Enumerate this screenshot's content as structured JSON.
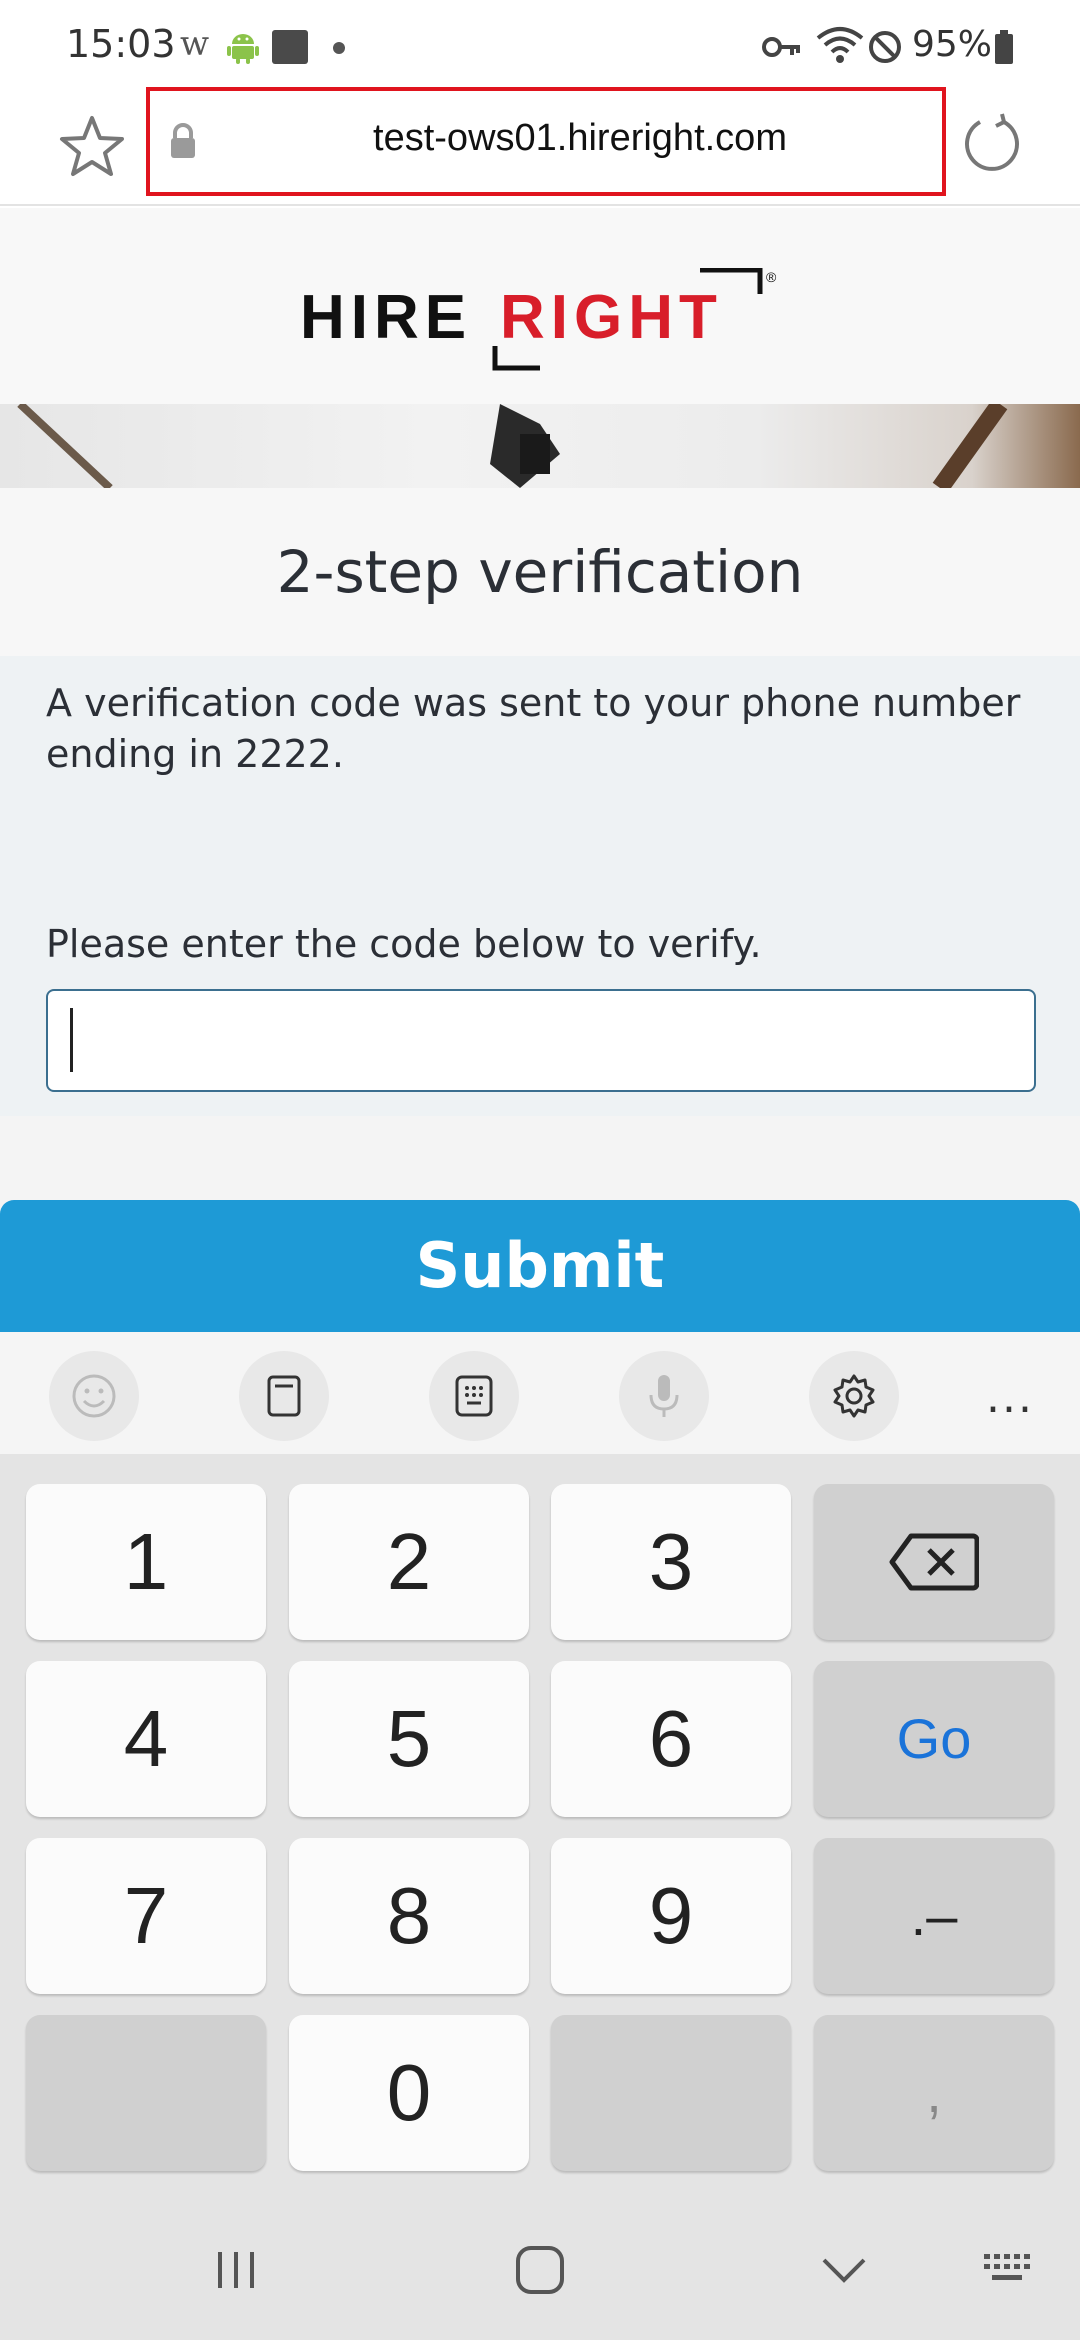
{
  "status_bar": {
    "time": "15:03",
    "w_icon_glyph": "w",
    "battery": "95%"
  },
  "browser": {
    "url": "test-ows01.hireright.com",
    "highlight_color": "#e0141e"
  },
  "page": {
    "logo": {
      "word1": "HIRE",
      "word2": "RIGHT",
      "mark": "®"
    },
    "title": "2-step verification",
    "message": "A verification code was sent to your phone number ending in 2222.",
    "prompt": "Please enter the code below to verify.",
    "code_value": "",
    "submit_label": "Submit",
    "accent_color": "#1e9ad6"
  },
  "keyboard": {
    "tools": [
      "emoji-icon",
      "clipboard-icon",
      "keypad-icon",
      "microphone-icon",
      "settings-icon",
      "more-icon"
    ],
    "more_label": "...",
    "rows": [
      [
        "1",
        "2",
        "3",
        "⌫"
      ],
      [
        "4",
        "5",
        "6",
        "Go"
      ],
      [
        "7",
        "8",
        "9",
        ".–"
      ],
      [
        "",
        "0",
        "",
        ","
      ]
    ]
  },
  "nav_bar": {
    "buttons": [
      "recents-icon",
      "home-icon",
      "back-icon",
      "keyboard-switch-icon"
    ]
  }
}
